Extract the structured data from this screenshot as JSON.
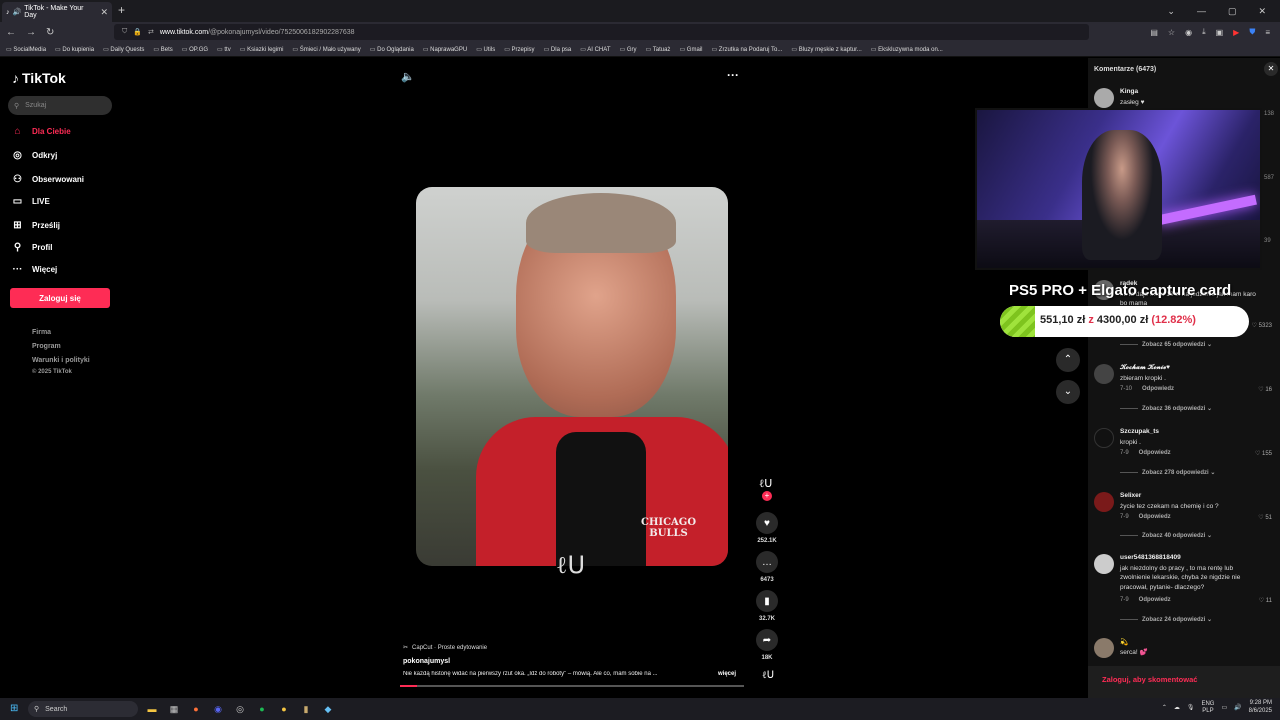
{
  "browser": {
    "tab_title": "TikTok - Make Your Day",
    "url_host": "www.tiktok.com",
    "url_path": "/@pokonajumysl/video/7525006182902287638",
    "bookmarks": [
      "SocialMedia",
      "Do kupienia",
      "Daily Quests",
      "Bets",
      "OP.GG",
      "ttv",
      "Ksiazki legimi",
      "Śmieci / Mało używany",
      "Do Oglądania",
      "NaprawaGPU",
      "Utils",
      "Przepisy",
      "Dla psa",
      "AI CHAT",
      "Gry",
      "Tatuaż",
      "Gmail",
      "Zrzutka na Podaruj To...",
      "Bluzy męskie z kaptur...",
      "Ekskluzywna moda on..."
    ]
  },
  "sidebar": {
    "logo": "TikTok",
    "search_placeholder": "Szukaj",
    "items": [
      {
        "label": "Dla Ciebie",
        "icon": "home-icon"
      },
      {
        "label": "Odkryj",
        "icon": "compass-icon"
      },
      {
        "label": "Obserwowani",
        "icon": "following-icon"
      },
      {
        "label": "LIVE",
        "icon": "live-icon"
      },
      {
        "label": "Prześlij",
        "icon": "upload-icon"
      },
      {
        "label": "Profil",
        "icon": "profile-icon"
      },
      {
        "label": "Więcej",
        "icon": "more-icon"
      }
    ],
    "login_label": "Zaloguj się",
    "footer": [
      "Firma",
      "Program",
      "Warunki i polityki",
      "© 2025 TikTok"
    ]
  },
  "video": {
    "jacket_text": "CHICAGO\nBULLS",
    "watermark": "ℓᑌ",
    "progress": 0.05,
    "capcut_label": "CapCut · Proste edytowanie",
    "author": "pokonajumysl",
    "description": "Nie każdą historię widać na pierwszy rzut oka. „Idź do roboty\" – mówią. Ale co, mam sobie na ...",
    "more_label": "więcej",
    "avatar_glyph": "ℓᑌ"
  },
  "actions": {
    "likes": "252.1K",
    "comments": "6473",
    "saves": "32.7K",
    "shares": "18K"
  },
  "comments": {
    "title": "Komentarze (6473)",
    "side_counts": [
      "138",
      "587",
      "39"
    ],
    "items": [
      {
        "user": "Kinga",
        "text": "zasłeg ♥"
      },
      {
        "user": "radek",
        "text": "...i to daje ...mu 10 zł na jedzenie jak mam karo bo mama",
        "likes": "5323",
        "replies": "Zobacz 65 odpowiedzi"
      },
      {
        "user": "𝓚𝓸𝓬𝓱𝓪𝓶 𝓚𝓸𝓷𝓲𝓮♥",
        "text": "zbieram kropki .",
        "date": "7-10",
        "reply": "Odpowiedz",
        "likes": "16",
        "replies": "Zobacz 36 odpowiedzi"
      },
      {
        "user": "Szczupak_ts",
        "text": "kropki .",
        "date": "7-9",
        "reply": "Odpowiedz",
        "likes": "155",
        "replies": "Zobacz 278 odpowiedzi"
      },
      {
        "user": "Selixer",
        "text": "życie tez czekam na chemię i co ?",
        "date": "7-9",
        "reply": "Odpowiedz",
        "likes": "51",
        "replies": "Zobacz 40 odpowiedzi"
      },
      {
        "user": "user5481368818409",
        "text": "jak niezdolny do pracy , to ma rentę lub zwolnienie lekarskie, chyba że nigdzie nie pracował, pytanie- dlaczego?",
        "date": "7-9",
        "reply": "Odpowiedz",
        "likes": "11",
        "replies": "Zobacz 24 odpowiedzi"
      },
      {
        "user": "💫",
        "text": "serca! 💕"
      }
    ],
    "login_prompt": "Zaloguj, aby skomentować"
  },
  "overlay": {
    "promo_title": "PS5 PRO + Elgato capture card",
    "goal_current": "551,10 zł",
    "goal_sep": "z",
    "goal_target": "4300,00 zł",
    "goal_pct": "(12.82%)",
    "goal_fraction": 0.1282
  },
  "taskbar": {
    "search_label": "Search",
    "lang": "ENG\nPLP",
    "time": "9:28 PM",
    "date": "8/6/2025"
  },
  "colors": {
    "accent": "#fe2c55",
    "goal_fill": "#9fe33c"
  }
}
